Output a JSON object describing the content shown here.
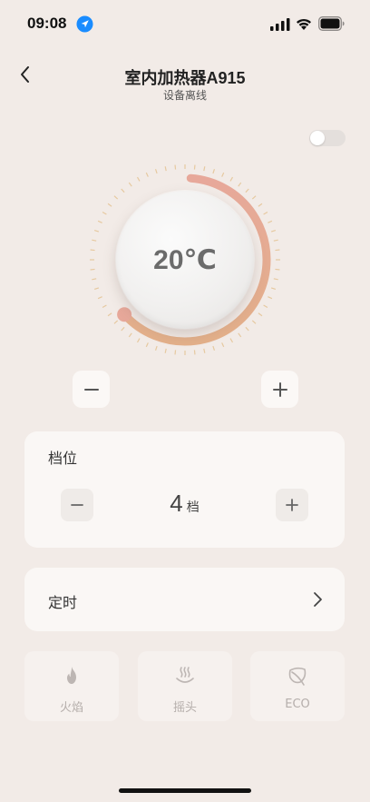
{
  "status_bar": {
    "time": "09:08",
    "icons": [
      "location-arrow-icon",
      "signal-icon",
      "wifi-icon",
      "battery-icon"
    ]
  },
  "nav": {
    "back_icon": "chevron-left-icon",
    "title": "室内加热器A915",
    "subtitle": "设备离线"
  },
  "power_toggle": {
    "on": false
  },
  "dial": {
    "temperature": "20℃",
    "arc_gradient": [
      "#e7a89a",
      "#e3b08a"
    ]
  },
  "temp_controls": {
    "minus_icon": "minus-icon",
    "plus_icon": "plus-icon"
  },
  "gear": {
    "title": "档位",
    "value": "4",
    "unit": "档"
  },
  "timer": {
    "label": "定时",
    "arrow_icon": "chevron-right-icon"
  },
  "modes": [
    {
      "label": "火焰",
      "icon": "flame-icon"
    },
    {
      "label": "摇头",
      "icon": "swing-icon"
    },
    {
      "label": "ECO",
      "icon": "leaf-icon"
    }
  ],
  "colors": {
    "background": "#f2ebe7",
    "card": "#faf7f5",
    "accent_start": "#e7a89a",
    "accent_end": "#e3b08a",
    "tick": "#e6c9a0",
    "disabled_text": "#b5aeab"
  }
}
